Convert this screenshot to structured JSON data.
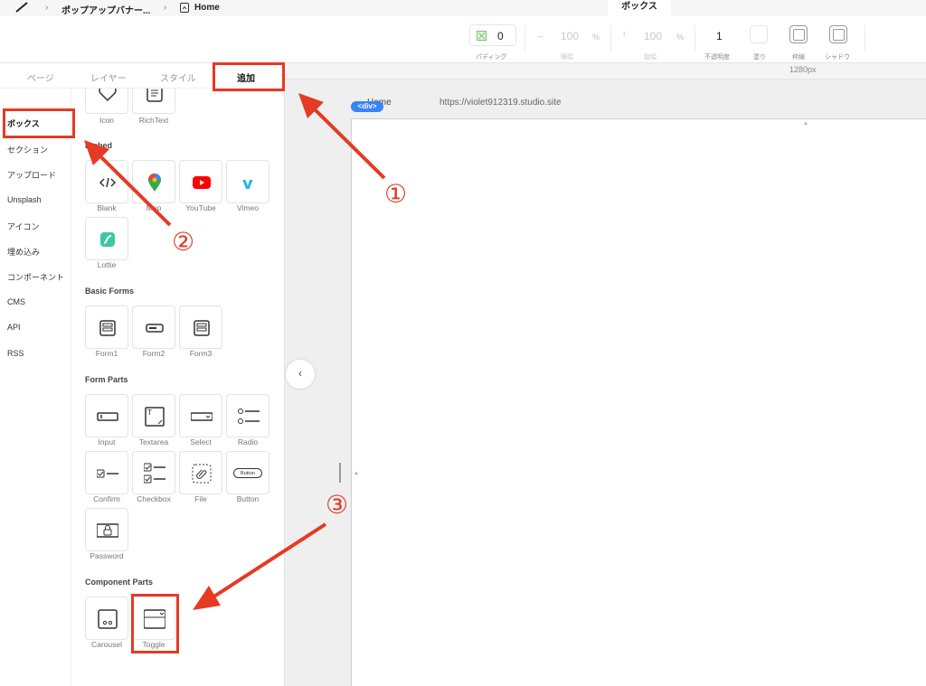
{
  "topbar": {
    "breadcrumb_project": "ポップアップバナー...",
    "breadcrumb_page": "Home",
    "inspector_tab": "ボックス"
  },
  "properties": {
    "padding_value": "0",
    "padding_label": "パディング",
    "width_value": "100",
    "width_unit": "%",
    "width_label": "横幅",
    "height_value": "100",
    "height_unit": "%",
    "height_label": "縦幅",
    "opacity_value": "1",
    "opacity_label": "不透明度",
    "fill_label": "塗り",
    "border_label": "枠線",
    "shadow_label": "シャドウ"
  },
  "ruler": {
    "width_label": "1280px"
  },
  "panel": {
    "tabs": [
      "ページ",
      "レイヤー",
      "スタイル",
      "追加"
    ],
    "categories": [
      "ボックス",
      "セクション",
      "アップロード",
      "Unsplash",
      "アイコン",
      "埋め込み",
      "コンポーネント",
      "CMS",
      "API",
      "RSS"
    ],
    "partial_row": [
      "Icon",
      "RichText"
    ],
    "embed_title": "Embed",
    "embed_items": [
      "Blank",
      "Map",
      "YouTube",
      "Vimeo",
      "Lottie"
    ],
    "basic_forms_title": "Basic Forms",
    "basic_forms_items": [
      "Form1",
      "Form2",
      "Form3"
    ],
    "form_parts_title": "Form Parts",
    "form_parts_items": [
      "Input",
      "Textarea",
      "Select",
      "Radio",
      "Confirm",
      "Checkbox",
      "File",
      "Button",
      "Password"
    ],
    "button_tile_text": "Button",
    "component_parts_title": "Component Parts",
    "component_parts_items": [
      "Carousel",
      "Toggle"
    ]
  },
  "canvas": {
    "page_name": "Home",
    "page_url": "https://violet912319.studio.site",
    "selection_badge": "<div>"
  },
  "annotations": [
    "①",
    "②",
    "③"
  ],
  "colors": {
    "annotation_red": "#e53a23",
    "selection_blue": "#3b82f6"
  }
}
